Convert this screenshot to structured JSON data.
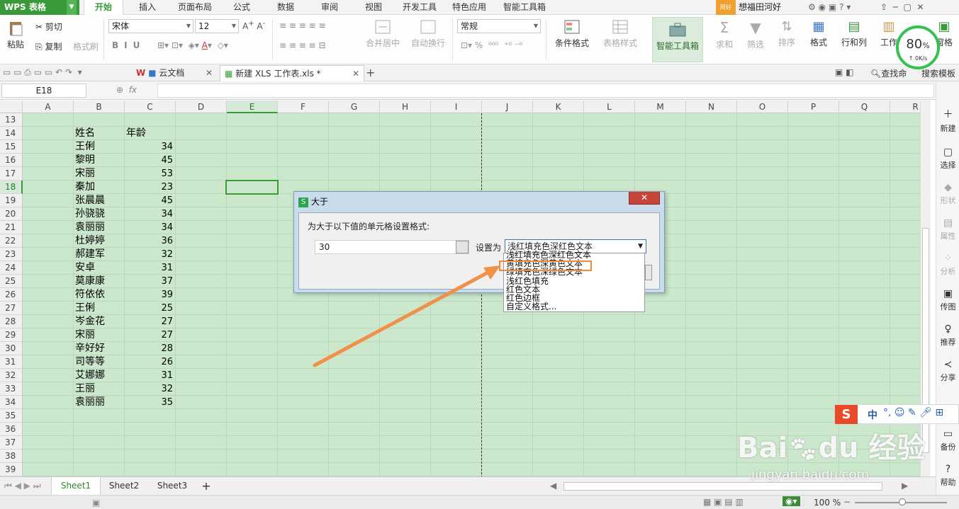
{
  "menubar": {
    "app_name": "WPS 表格",
    "tabs": [
      "开始",
      "插入",
      "页面布局",
      "公式",
      "数据",
      "审阅",
      "视图",
      "开发工具",
      "特色应用",
      "智能工具箱"
    ],
    "user_badge": "阿好",
    "user_name": "想福田河好",
    "colors": {
      "app_green": "#3a9a3a",
      "active_tab": "#3a9a3a"
    }
  },
  "ribbon": {
    "paste": "粘贴",
    "cut": "剪切",
    "copy": "复制",
    "format_painter": "格式刷",
    "font_name": "宋体",
    "font_size": "12",
    "merge_center": "合并居中",
    "wrap_text": "自动换行",
    "number_format": "常规",
    "cond_format": "条件格式",
    "table_style": "表格样式",
    "smart_toolbox": "智能工具箱",
    "sum": "求和",
    "filter": "筛选",
    "sort": "排序",
    "format": "格式",
    "rows_cols": "行和列",
    "worksheet": "工作",
    "freeze": "窗格",
    "speed_pct": "80",
    "speed_unit": "%",
    "speed_rate": "0K/s"
  },
  "tabbar": {
    "tabs": [
      {
        "label": "云文档"
      },
      {
        "label": "新建 XLS 工作表.xls *"
      }
    ],
    "search_label": "查找命",
    "search_templates": "搜索模板"
  },
  "formula_bar": {
    "name_box": "E18",
    "fx": "fx",
    "value": ""
  },
  "grid": {
    "columns": [
      "A",
      "B",
      "C",
      "D",
      "E",
      "F",
      "G",
      "H",
      "I",
      "J",
      "K",
      "L",
      "M",
      "N",
      "O",
      "P",
      "Q",
      "R"
    ],
    "selected_column": "E",
    "rows": [
      "13",
      "14",
      "15",
      "16",
      "17",
      "18",
      "19",
      "20",
      "21",
      "22",
      "23",
      "24",
      "25",
      "26",
      "27",
      "28",
      "29",
      "30",
      "31",
      "32",
      "33",
      "34",
      "35",
      "36",
      "37",
      "38",
      "39"
    ],
    "selected_row": "18",
    "header": {
      "name": "姓名",
      "age": "年龄"
    },
    "records": [
      {
        "name": "王俐",
        "age": "34"
      },
      {
        "name": "黎明",
        "age": "45"
      },
      {
        "name": "宋丽",
        "age": "53"
      },
      {
        "name": "秦加",
        "age": "23"
      },
      {
        "name": "张晨晨",
        "age": "45"
      },
      {
        "name": "孙骁骁",
        "age": "34"
      },
      {
        "name": "袁丽丽",
        "age": "34"
      },
      {
        "name": "杜婷婷",
        "age": "36"
      },
      {
        "name": "郝建军",
        "age": "32"
      },
      {
        "name": "安卓",
        "age": "31"
      },
      {
        "name": "莫康康",
        "age": "37"
      },
      {
        "name": "符依依",
        "age": "39"
      },
      {
        "name": "王俐",
        "age": "25"
      },
      {
        "name": "岑金花",
        "age": "27"
      },
      {
        "name": "宋丽",
        "age": "27"
      },
      {
        "name": "辛好好",
        "age": "28"
      },
      {
        "name": "司等等",
        "age": "26"
      },
      {
        "name": "艾娜娜",
        "age": "31"
      },
      {
        "name": "王丽",
        "age": "32"
      },
      {
        "name": "袁丽丽",
        "age": "35"
      }
    ]
  },
  "dialog": {
    "title": "大于",
    "close": "✕",
    "prompt": "为大于以下值的单元格设置格式:",
    "value": "30",
    "set_as_label": "设置为",
    "selected_option": "浅红填充色深红色文本",
    "options": [
      "浅红填充色深红色文本",
      "黄填充色深黄色文本",
      "绿填充色深绿色文本",
      "浅红色填充",
      "红色文本",
      "红色边框",
      "自定义格式..."
    ],
    "highlighted_option": "黄填充色深黄色文本",
    "highlight_color": "#f08a3c"
  },
  "sidepanel": {
    "items": [
      {
        "label": "新建",
        "enabled": true
      },
      {
        "label": "选择",
        "enabled": true
      },
      {
        "label": "形状",
        "enabled": false
      },
      {
        "label": "属性",
        "enabled": false
      },
      {
        "label": "分析",
        "enabled": false
      },
      {
        "label": "传图",
        "enabled": true
      },
      {
        "label": "推荐",
        "enabled": true
      },
      {
        "label": "分享",
        "enabled": true
      },
      {
        "label": "备份",
        "enabled": true
      },
      {
        "label": "帮助",
        "enabled": true
      }
    ]
  },
  "sheets": {
    "tabs": [
      "Sheet1",
      "Sheet2",
      "Sheet3"
    ],
    "active": "Sheet1",
    "add": "+"
  },
  "statusbar": {
    "zoom": "100 %"
  },
  "ime": {
    "logo": "S",
    "lang": "中"
  },
  "watermark": {
    "brand_mark": "Bai du 经验",
    "url": "jingyan.baidu.com"
  }
}
